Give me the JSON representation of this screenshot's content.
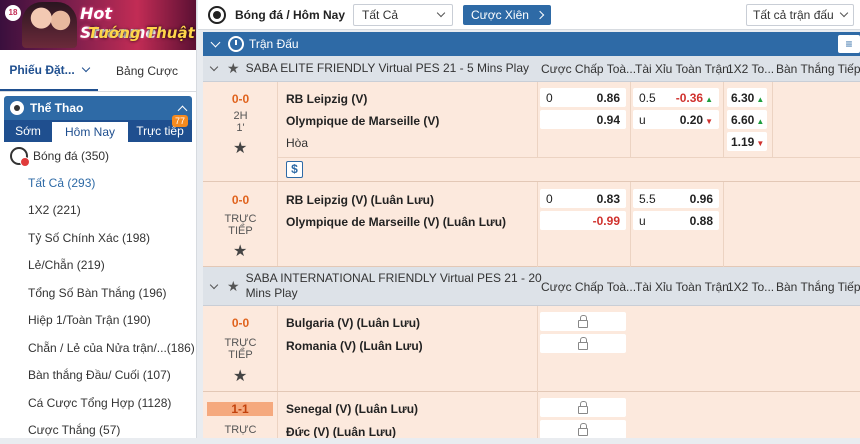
{
  "banner": {
    "line1": "Hot Streamer",
    "line2": "Tướng Thuật",
    "logo": "18"
  },
  "sidebar": {
    "tabs": [
      {
        "label": "Phiếu Đặt..."
      },
      {
        "label": "Bảng Cược"
      }
    ],
    "sport": "Thể Thao",
    "subtabs": [
      {
        "label": "Sớm"
      },
      {
        "label": "Hôm Nay"
      },
      {
        "label": "Trực tiếp"
      }
    ],
    "live_badge": "77",
    "category": "Bóng đá (350)",
    "items": [
      {
        "label": "Tất Cả (293)"
      },
      {
        "label": "1X2 (221)"
      },
      {
        "label": "Tỷ Số Chính Xác (198)"
      },
      {
        "label": "Lẻ/Chẵn (219)"
      },
      {
        "label": "Tổng Số Bàn Thắng (196)"
      },
      {
        "label": "Hiệp 1/Toàn Trận (190)"
      },
      {
        "label": "Chẵn / Lẻ của Nửa trận/...",
        "count": "(186)"
      },
      {
        "label": "Bàn thắng Đầu/ Cuối (107)"
      },
      {
        "label": "Cá Cược Tổng Hợp (1128)"
      },
      {
        "label": "Cược Thắng (57)"
      }
    ]
  },
  "topbar": {
    "title": "Bóng đá / Hôm Nay",
    "filter_value": "Tất Cả",
    "parlay_label": "Cược Xiên",
    "sort_value": "Tất cả trận đấu"
  },
  "section": {
    "title": "Trận Đấu",
    "menu_icon": "≡"
  },
  "columns": {
    "handicap": "Cược Chấp Toà...",
    "overunder": "Tài Xỉu Toàn Trận",
    "x12": "1X2 To...",
    "goals": "Bàn Thắng Tiếp..."
  },
  "leagues": [
    {
      "name": "SABA ELITE FRIENDLY Virtual PES 21 - 5 Mins Play",
      "matches": [
        {
          "score": "0-0",
          "status1": "2H",
          "status2": "1'",
          "home": "RB Leipzig (V)",
          "away": "Olympique de Marseille (V)",
          "draw": "Hòa",
          "hdp": [
            {
              "line": "0",
              "odds": "0.86"
            },
            {
              "line": "",
              "odds": "0.94"
            }
          ],
          "ou": [
            {
              "line": "0.5",
              "odds": "-0.36",
              "trend": "▲"
            },
            {
              "line": "u",
              "odds": "0.20",
              "trend": "▼"
            }
          ],
          "x12": [
            {
              "odds": "6.30",
              "trend": "▲"
            },
            {
              "odds": "6.60",
              "trend": "▲"
            },
            {
              "odds": "1.19",
              "trend": "▼"
            }
          ],
          "more": "$"
        },
        {
          "score": "0-0",
          "status1": "TRỰC",
          "status2": "TIẾP",
          "home": "RB Leipzig (V) (Luân Lưu)",
          "away": "Olympique de Marseille (V) (Luân Lưu)",
          "hdp": [
            {
              "line": "0",
              "odds": "0.83"
            },
            {
              "line": "",
              "odds": "-0.99"
            }
          ],
          "ou": [
            {
              "line": "5.5",
              "odds": "0.96"
            },
            {
              "line": "u",
              "odds": "0.88"
            }
          ]
        }
      ]
    },
    {
      "name": "SABA INTERNATIONAL FRIENDLY Virtual PES 21 - 20 Mins Play",
      "matches": [
        {
          "score": "0-0",
          "status1": "TRỰC",
          "status2": "TIẾP",
          "home": "Bulgaria (V) (Luân Lưu)",
          "away": "Romania (V) (Luân Lưu)"
        },
        {
          "score": "1-1",
          "status1": "TRỰC",
          "home": "Senegal (V) (Luân Lưu)",
          "away": "Đức (V) (Luân Lưu)"
        }
      ]
    }
  ]
}
